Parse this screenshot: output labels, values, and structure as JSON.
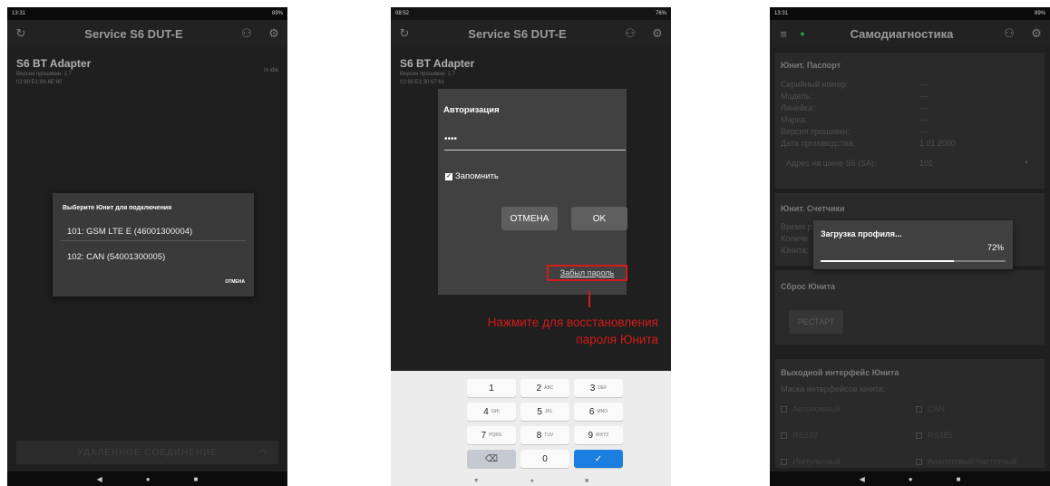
{
  "screen1": {
    "status": {
      "time": "13:31",
      "right": "89%"
    },
    "appbar": {
      "title": "Service S6 DUT-E"
    },
    "device": {
      "name": "S6 BT Adapter",
      "firmware": "Версия прошивки: 1.7",
      "mac": "02:80:E1:9A:6E:80",
      "status": "In idle"
    },
    "dialog": {
      "title": "Выберите Юнит для подключения",
      "options": [
        "101: GSM LTE E (46001300004)",
        "102: CAN (54001300005)"
      ],
      "cancel": "ОТМЕНА"
    },
    "bottom_button": "УДАЛЁННОЕ СОЕДИНЕНИЕ"
  },
  "screen2": {
    "status": {
      "time": "08:52",
      "right": "76%"
    },
    "appbar": {
      "title": "Service S6 DUT-E"
    },
    "device": {
      "name": "S6 BT Adapter",
      "firmware": "Версия прошивки: 1.7",
      "mac": "02:80:E1:30:67:61"
    },
    "dialog": {
      "title": "Авторизация",
      "password_value": "••••",
      "remember_label": "Запомнить",
      "remember_checked": true,
      "cancel": "ОТМЕНА",
      "ok": "OK",
      "forgot": "Забыл пароль"
    },
    "callout": {
      "line1": "Нажмите для восстановления",
      "line2": "пароля Юнита",
      "color": "#d41a1a"
    },
    "keypad": {
      "keys": [
        {
          "main": "1",
          "sub": ""
        },
        {
          "main": "2",
          "sub": "ABC"
        },
        {
          "main": "3",
          "sub": "DEF"
        },
        {
          "main": "4",
          "sub": "GHI"
        },
        {
          "main": "5",
          "sub": "JKL"
        },
        {
          "main": "6",
          "sub": "MNO"
        },
        {
          "main": "7",
          "sub": "PQRS"
        },
        {
          "main": "8",
          "sub": "TUV"
        },
        {
          "main": "9",
          "sub": "WXYZ"
        },
        {
          "main": "⌫",
          "sub": ""
        },
        {
          "main": "0",
          "sub": ""
        },
        {
          "main": "✓",
          "sub": ""
        }
      ]
    }
  },
  "screen3": {
    "status": {
      "time": "13:31",
      "right": "89%"
    },
    "appbar": {
      "title": "Самодиагностика"
    },
    "passport": {
      "title": "Юнит. Паспорт",
      "rows": [
        {
          "label": "Серийный номер:",
          "value": "—"
        },
        {
          "label": "Модель:",
          "value": "—"
        },
        {
          "label": "Линейка:",
          "value": "—"
        },
        {
          "label": "Марка:",
          "value": "—"
        },
        {
          "label": "Версия прошивки:",
          "value": "—"
        },
        {
          "label": "Дата производства:",
          "value": "1.01.2000"
        }
      ],
      "address_label": "Адрес на шине S6 (SA):",
      "address_value": "101"
    },
    "counters": {
      "title": "Юнит. Счетчики",
      "rows": [
        "Время р",
        "Количе",
        "Юнита:"
      ]
    },
    "progress": {
      "title": "Загрузка профиля...",
      "percent_text": "72%",
      "value": 0.72
    },
    "reset": {
      "title": "Сброс Юнита",
      "button": "РЕСТАРТ"
    },
    "output": {
      "title": "Выходной интерфейс Юнита",
      "mask": "Маска интерфейсов юнита:",
      "checkboxes": [
        "Автономный",
        "CAN",
        "RS232",
        "RS485",
        "Импульсный",
        "Аналоговый/Частотный"
      ]
    }
  }
}
